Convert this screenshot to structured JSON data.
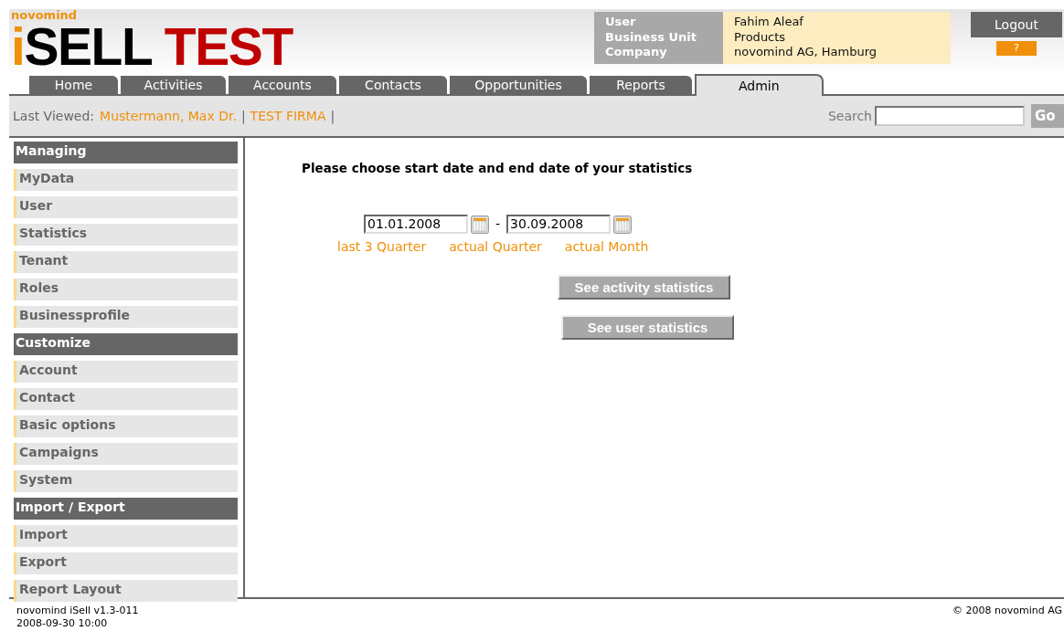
{
  "logo": {
    "brand": "novomind",
    "accent": "i",
    "name": "SELL",
    "suffix": "TEST"
  },
  "user_info": {
    "labels": [
      "User",
      "Business Unit",
      "Company"
    ],
    "values": [
      "Fahim Aleaf",
      "Products",
      "novomind AG, Hamburg"
    ]
  },
  "logout": "Logout",
  "help": "?",
  "tabs": [
    {
      "label": "Home",
      "selected": false
    },
    {
      "label": "Activities",
      "selected": false
    },
    {
      "label": "Accounts",
      "selected": false
    },
    {
      "label": "Contacts",
      "selected": false
    },
    {
      "label": "Opportunities",
      "selected": false
    },
    {
      "label": "Reports",
      "selected": false
    },
    {
      "label": "Admin",
      "selected": true
    }
  ],
  "last_viewed": {
    "label": "Last Viewed:",
    "links": [
      "Mustermann, Max Dr.",
      "TEST FIRMA"
    ],
    "separator": "|"
  },
  "search": {
    "label": "Search",
    "button": "Go"
  },
  "sidebar": [
    {
      "title": "Managing",
      "items": [
        "MyData",
        "User",
        "Statistics",
        "Tenant",
        "Roles",
        "Businessprofile"
      ]
    },
    {
      "title": "Customize",
      "items": [
        "Account",
        "Contact",
        "Basic options",
        "Campaigns",
        "System"
      ]
    },
    {
      "title": "Import / Export",
      "items": [
        "Import",
        "Export",
        "Report Layout"
      ]
    }
  ],
  "main": {
    "heading": "Please choose start date and end date of your statistics",
    "start_date": "01.01.2008",
    "dash": "-",
    "end_date": "30.09.2008",
    "presets": [
      "last 3 Quarter",
      "actual Quarter",
      "actual Month"
    ],
    "buttons": [
      "See activity statistics",
      "See user statistics"
    ]
  },
  "footer": {
    "version": "novomind iSell v1.3-011",
    "timestamp": "2008-09-30 10:00",
    "copyright": "© 2008 novomind AG"
  }
}
